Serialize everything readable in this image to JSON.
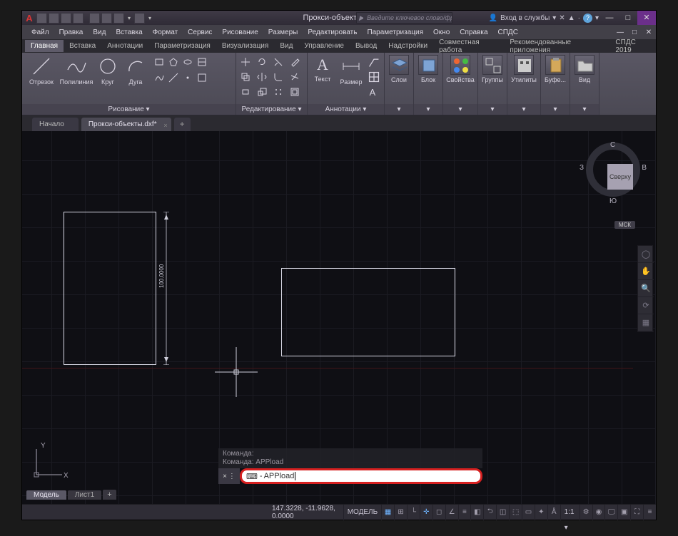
{
  "app_logo": "A",
  "title": "Прокси-объекты.dxf",
  "search_placeholder": "Введите ключевое слово/фразу",
  "signin_label": "Вход в службы",
  "window_buttons": {
    "min": "—",
    "max": "□",
    "close": "✕"
  },
  "menu": [
    "Файл",
    "Правка",
    "Вид",
    "Вставка",
    "Формат",
    "Сервис",
    "Рисование",
    "Размеры",
    "Редактировать",
    "Параметризация",
    "Окно",
    "Справка",
    "СПДС"
  ],
  "menu_right": [
    "—",
    "□",
    "✕"
  ],
  "ribbon_tabs": [
    "Главная",
    "Вставка",
    "Аннотации",
    "Параметризация",
    "Визуализация",
    "Вид",
    "Управление",
    "Вывод",
    "Надстройки",
    "Совместная работа",
    "Рекомендованные приложения",
    "СПДС 2019"
  ],
  "ribbon": {
    "draw": {
      "name": "Рисование ▾",
      "items": [
        "Отрезок",
        "Полилиния",
        "Круг",
        "Дуга"
      ]
    },
    "edit": {
      "name": "Редактирование ▾"
    },
    "annot": {
      "name": "Аннотации ▾",
      "items": [
        "Текст",
        "Размер"
      ]
    },
    "panels": [
      "Слои",
      "Блок",
      "Свойства",
      "Группы",
      "Утилиты",
      "Буфе...",
      "Вид"
    ]
  },
  "doc_tabs": [
    {
      "label": "Начало",
      "active": false,
      "closable": false
    },
    {
      "label": "Прокси-объекты.dxf*",
      "active": true,
      "closable": true
    }
  ],
  "viewcube": {
    "face": "Сверху",
    "n": "С",
    "s": "Ю",
    "e": "В",
    "w": "З",
    "cs": "МСК"
  },
  "dimension": "100.0000",
  "command_history": [
    "Команда:",
    "Команда: APPload"
  ],
  "command_current": "APPload",
  "command_icon": "⌨",
  "model_tabs": [
    "Модель",
    "Лист1"
  ],
  "status": {
    "coord": "147.3228, -11.9628, 0.0000",
    "model": "МОДЕЛЬ",
    "scale": "1:1"
  },
  "ucs": {
    "x": "X",
    "y": "Y"
  }
}
